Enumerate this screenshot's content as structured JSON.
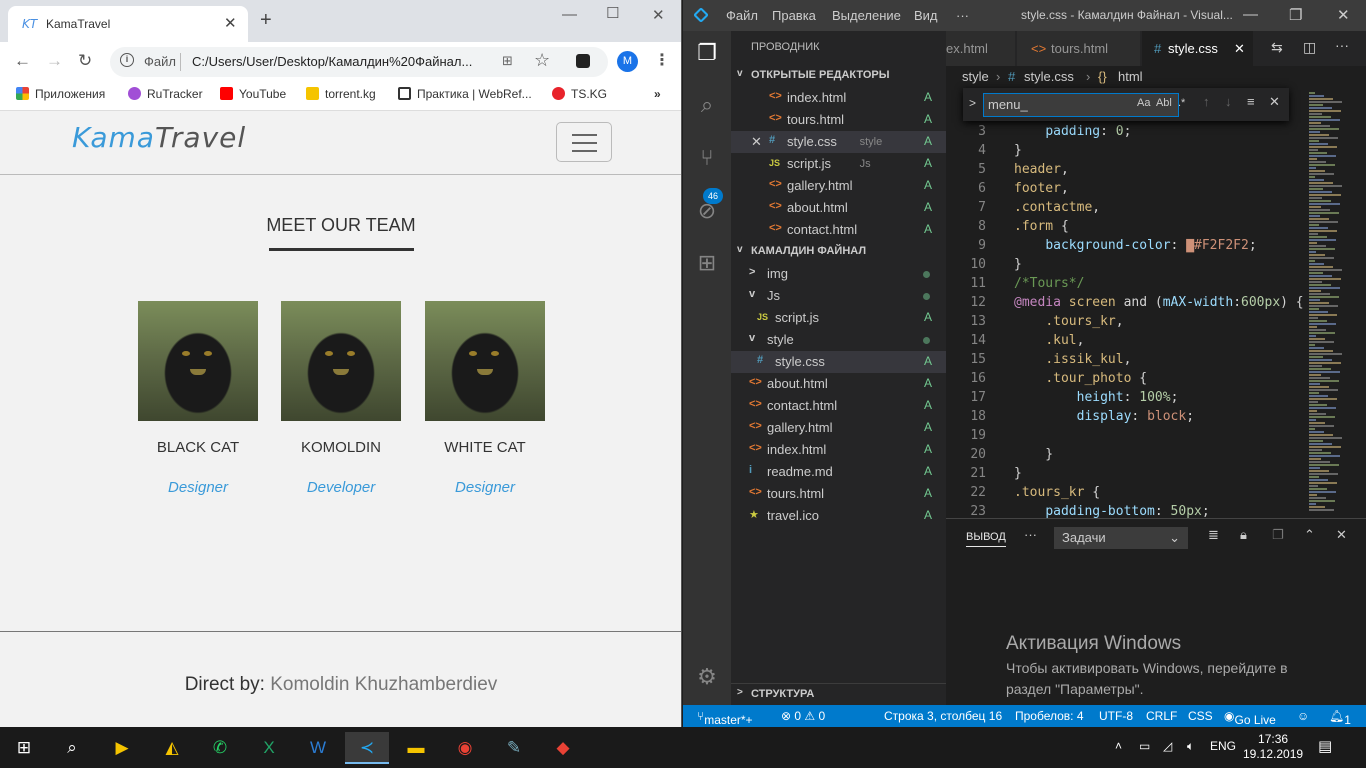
{
  "chrome": {
    "tab_favicon": "KT",
    "tab_title": "KamaTravel",
    "omnibox_file_label": "Файл",
    "url": "C:/Users/User/Desktop/Камалдин%20Файнал...",
    "avatar_letter": "M",
    "bookmarks": [
      {
        "label": "Приложения",
        "color": "#e94235"
      },
      {
        "label": "RuTracker",
        "color": "#a14fd6"
      },
      {
        "label": "YouTube",
        "color": "#ff0000"
      },
      {
        "label": "torrent.kg",
        "color": "#f5c400"
      },
      {
        "label": "Практика | WebRef...",
        "color": "#333333"
      },
      {
        "label": "TS.KG",
        "color": "#e8232b"
      }
    ]
  },
  "site": {
    "logo_a": "Kama",
    "logo_b": "Travel",
    "section_title": "MEET OUR TEAM",
    "members": [
      {
        "name": "BLACK CAT",
        "role": "Designer"
      },
      {
        "name": "KOMOLDIN",
        "role": "Developer"
      },
      {
        "name": "WHITE CAT",
        "role": "Designer"
      }
    ],
    "footer_prefix": "Direct by:",
    "footer_name": "Komoldin Khuzhamberdiev",
    "accent": "#3a9ad9"
  },
  "vscode": {
    "menu": [
      "Файл",
      "Правка",
      "Выделение",
      "Вид",
      "···"
    ],
    "window_title": "style.css - Камалдин Файнал - Visual...",
    "explorer_title": "ПРОВОДНИК",
    "scm_badge": "46",
    "open_editors_title": "ОТКРЫТЫЕ РЕДАКТОРЫ",
    "open_editors": [
      {
        "icon": "<>",
        "name": "index.html",
        "status": "A"
      },
      {
        "icon": "<>",
        "name": "tours.html",
        "status": "A"
      },
      {
        "icon": "#",
        "name": "style.css",
        "extra": "style",
        "status": "A"
      },
      {
        "icon": "JS",
        "name": "script.js",
        "extra": "Js",
        "status": "A"
      },
      {
        "icon": "<>",
        "name": "gallery.html",
        "status": "A"
      },
      {
        "icon": "<>",
        "name": "about.html",
        "status": "A"
      },
      {
        "icon": "<>",
        "name": "contact.html",
        "status": "A"
      }
    ],
    "folder_title": "КАМАЛДИН ФАЙНАЛ",
    "folder_items": [
      {
        "icon": ">",
        "name": "img",
        "status": ""
      },
      {
        "icon": "v",
        "name": "Js",
        "status": ""
      },
      {
        "icon": "JS",
        "name": "script.js",
        "status": "A"
      },
      {
        "icon": "v",
        "name": "style",
        "status": ""
      },
      {
        "icon": "#",
        "name": "style.css",
        "status": "A"
      },
      {
        "icon": "<>",
        "name": "about.html",
        "status": "A"
      },
      {
        "icon": "<>",
        "name": "contact.html",
        "status": "A"
      },
      {
        "icon": "<>",
        "name": "gallery.html",
        "status": "A"
      },
      {
        "icon": "<>",
        "name": "index.html",
        "status": "A"
      },
      {
        "icon": "i",
        "name": "readme.md",
        "status": "A"
      },
      {
        "icon": "<>",
        "name": "tours.html",
        "status": "A"
      },
      {
        "icon": "★",
        "name": "travel.ico",
        "status": "A"
      }
    ],
    "structure_title": "СТРУКТУРА",
    "tabs": [
      "ex.html",
      "tours.html",
      "style.css"
    ],
    "breadcrumb": [
      "style",
      "style.css",
      "html"
    ],
    "find_value": "menu_",
    "find_opts": "Aa  Abl  .*",
    "code_lines": [
      {
        "n": "3",
        "html": "    <span class='p'>padding</span>: <span class='n'>0</span>;"
      },
      {
        "n": "4",
        "html": "}"
      },
      {
        "n": "5",
        "html": "<span class='k'>header</span>,"
      },
      {
        "n": "6",
        "html": "<span class='k'>footer</span>,"
      },
      {
        "n": "7",
        "html": "<span class='k'>.contactme</span>,"
      },
      {
        "n": "8",
        "html": "<span class='k'>.form</span> {"
      },
      {
        "n": "9",
        "html": "    <span class='p'>background-color</span>: <span class='v'>▇#F2F2F2</span>;"
      },
      {
        "n": "10",
        "html": "}"
      },
      {
        "n": "11",
        "html": "<span class='c'>/*Tours*/</span>"
      },
      {
        "n": "12",
        "html": "<span class='m'>@media</span> <span class='k'>screen</span> and (<span class='p'>mAX-width</span>:<span class='n'>600px</span>) {"
      },
      {
        "n": "13",
        "html": "    <span class='k'>.tours_kr</span>,"
      },
      {
        "n": "14",
        "html": "    <span class='k'>.kul</span>,"
      },
      {
        "n": "15",
        "html": "    <span class='k'>.issik_kul</span>,"
      },
      {
        "n": "16",
        "html": "    <span class='k'>.tour_photo</span> {"
      },
      {
        "n": "17",
        "html": "        <span class='p'>height</span>: <span class='n'>100%</span>;"
      },
      {
        "n": "18",
        "html": "        <span class='p'>display</span>: <span class='v'>block</span>;"
      },
      {
        "n": "19",
        "html": ""
      },
      {
        "n": "20",
        "html": "    }"
      },
      {
        "n": "21",
        "html": "}"
      },
      {
        "n": "22",
        "html": "<span class='k'>.tours_kr</span> {"
      },
      {
        "n": "23",
        "html": "    <span class='p'>padding-bottom</span>: <span class='n'>50px</span>;"
      }
    ],
    "panel_tab": "ВЫВОД",
    "panel_more": "···",
    "panel_select": "Задачи",
    "activation_title": "Активация Windows",
    "activation_text": "Чтобы активировать Windows, перейдите в раздел \"Параметры\".",
    "status": {
      "branch": "master*+",
      "problems": "⊗ 0 ⚠ 0",
      "position": "Строка 3, столбец 16",
      "spaces": "Пробелов: 4",
      "encoding": "UTF-8",
      "eol": "CRLF",
      "lang": "CSS",
      "golive": "Go Live",
      "notif": "1"
    }
  },
  "taskbar": {
    "lang": "ENG",
    "time": "17:36",
    "date": "19.12.2019"
  }
}
